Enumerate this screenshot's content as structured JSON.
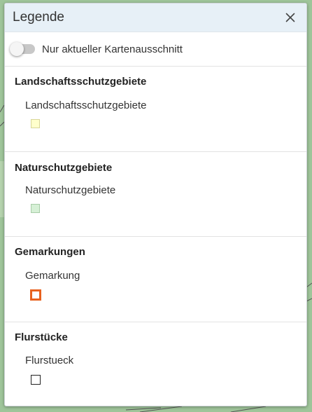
{
  "legend": {
    "title": "Legende",
    "close_icon": "close-x-icon",
    "toggle": {
      "label": "Nur aktueller Kartenausschnitt",
      "checked": false
    },
    "sections": [
      {
        "title": "Landschaftsschutzgebiete",
        "layer_label": "Landschaftsschutzgebiete",
        "swatch_fill": "#ffffcc",
        "swatch_border": "#d8d69a"
      },
      {
        "title": "Naturschutzgebiete",
        "layer_label": "Naturschutzgebiete",
        "swatch_fill": "#d6f0d6",
        "swatch_border": "#a8cca8"
      },
      {
        "title": "Gemarkungen",
        "layer_label": "Gemarkung",
        "swatch_fill": "#ffffff",
        "swatch_border": "#e8621f"
      },
      {
        "title": "Flurstücke",
        "layer_label": "Flurstueck",
        "swatch_fill": "#ffffff",
        "swatch_border": "#222222"
      }
    ]
  },
  "colors": {
    "header_bg": "#e7f0f7",
    "map_bg": "#9fc59a"
  }
}
